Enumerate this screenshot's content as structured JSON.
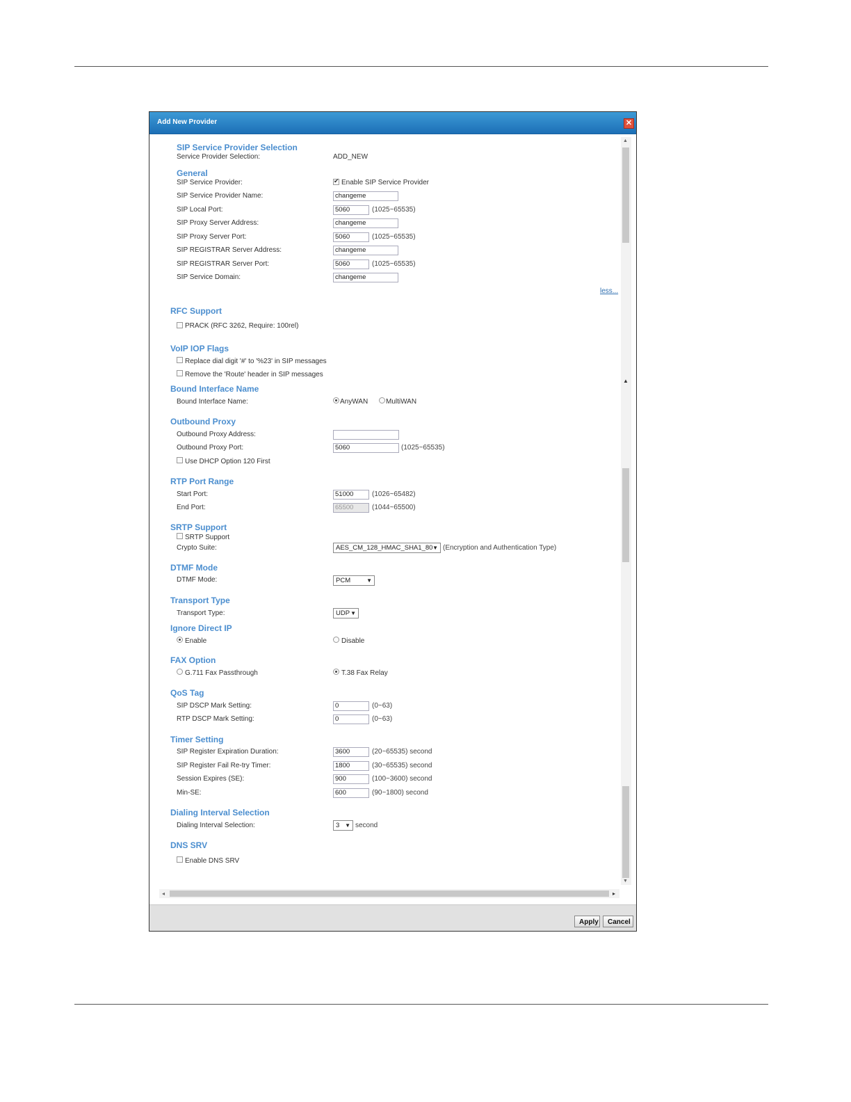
{
  "dialog": {
    "title": "Add New Provider",
    "close_label": "✕"
  },
  "sections": {
    "sip_service_provider_selection": {
      "title": "SIP Service Provider Selection",
      "label": "Service Provider Selection:",
      "value": "ADD_NEW"
    },
    "general": {
      "title": "General",
      "sip_service_provider_label": "SIP Service Provider:",
      "enable_label": "Enable SIP Service Provider",
      "provider_name_label": "SIP Service Provider Name:",
      "provider_name_value": "changeme",
      "local_port_label": "SIP Local Port:",
      "local_port_value": "5060",
      "local_port_hint": "(1025~65535)",
      "proxy_address_label": "SIP Proxy Server Address:",
      "proxy_address_value": "changeme",
      "proxy_port_label": "SIP Proxy Server Port:",
      "proxy_port_value": "5060",
      "proxy_port_hint": "(1025~65535)",
      "registrar_address_label": "SIP REGISTRAR Server Address:",
      "registrar_address_value": "changeme",
      "registrar_port_label": "SIP REGISTRAR Server Port:",
      "registrar_port_value": "5060",
      "registrar_port_hint": "(1025~65535)",
      "domain_label": "SIP Service Domain:",
      "domain_value": "changeme",
      "less_link": "less..."
    },
    "rfc_support": {
      "title": "RFC Support",
      "prack_label": "PRACK (RFC 3262, Require: 100rel)"
    },
    "voip_iop_flags": {
      "title": "VoIP IOP Flags",
      "replace_label": "Replace dial digit '#' to '%23' in SIP messages",
      "remove_label": "Remove the 'Route' header in SIP messages"
    },
    "bound_interface": {
      "title": "Bound Interface Name",
      "label": "Bound Interface Name:",
      "option_any": "AnyWAN",
      "option_multi": "MultiWAN"
    },
    "outbound_proxy": {
      "title": "Outbound Proxy",
      "address_label": "Outbound Proxy Address:",
      "address_value": "",
      "port_label": "Outbound Proxy Port:",
      "port_value": "5060",
      "port_hint": "(1025~65535)",
      "dhcp_label": "Use DHCP Option 120 First"
    },
    "rtp_port_range": {
      "title": "RTP Port Range",
      "start_label": "Start Port:",
      "start_value": "51000",
      "start_hint": "(1026~65482)",
      "end_label": "End Port:",
      "end_value": "65500",
      "end_hint": "(1044~65500)"
    },
    "srtp_support": {
      "title": "SRTP Support",
      "srtp_label": "SRTP Support",
      "crypto_label": "Crypto Suite:",
      "crypto_value": "AES_CM_128_HMAC_SHA1_80",
      "crypto_hint": "(Encryption and Authentication Type)"
    },
    "dtmf_mode": {
      "title": "DTMF Mode",
      "label": "DTMF Mode:",
      "value": "PCM"
    },
    "transport_type": {
      "title": "Transport Type",
      "label": "Transport Type:",
      "value": "UDP"
    },
    "ignore_direct_ip": {
      "title": "Ignore Direct IP",
      "enable_label": "Enable",
      "disable_label": "Disable"
    },
    "fax_option": {
      "title": "FAX Option",
      "g711_label": "G.711 Fax Passthrough",
      "t38_label": "T.38 Fax Relay"
    },
    "qos_tag": {
      "title": "QoS Tag",
      "sip_dscp_label": "SIP DSCP Mark Setting:",
      "sip_dscp_value": "0",
      "sip_dscp_hint": "(0~63)",
      "rtp_dscp_label": "RTP DSCP Mark Setting:",
      "rtp_dscp_value": "0",
      "rtp_dscp_hint": "(0~63)"
    },
    "timer_setting": {
      "title": "Timer Setting",
      "expiration_label": "SIP Register Expiration Duration:",
      "expiration_value": "3600",
      "expiration_hint": "(20~65535) second",
      "retry_label": "SIP Register Fail Re-try Timer:",
      "retry_value": "1800",
      "retry_hint": "(30~65535) second",
      "session_label": "Session Expires (SE):",
      "session_value": "900",
      "session_hint": "(100~3600) second",
      "minse_label": "Min-SE:",
      "minse_value": "600",
      "minse_hint": "(90~1800) second"
    },
    "dialing_interval": {
      "title": "Dialing Interval Selection",
      "label": "Dialing Interval Selection:",
      "value": "3",
      "unit": "second"
    },
    "dns_srv": {
      "title": "DNS SRV",
      "enable_label": "Enable DNS SRV"
    }
  },
  "footer": {
    "apply_label": "Apply",
    "cancel_label": "Cancel"
  }
}
